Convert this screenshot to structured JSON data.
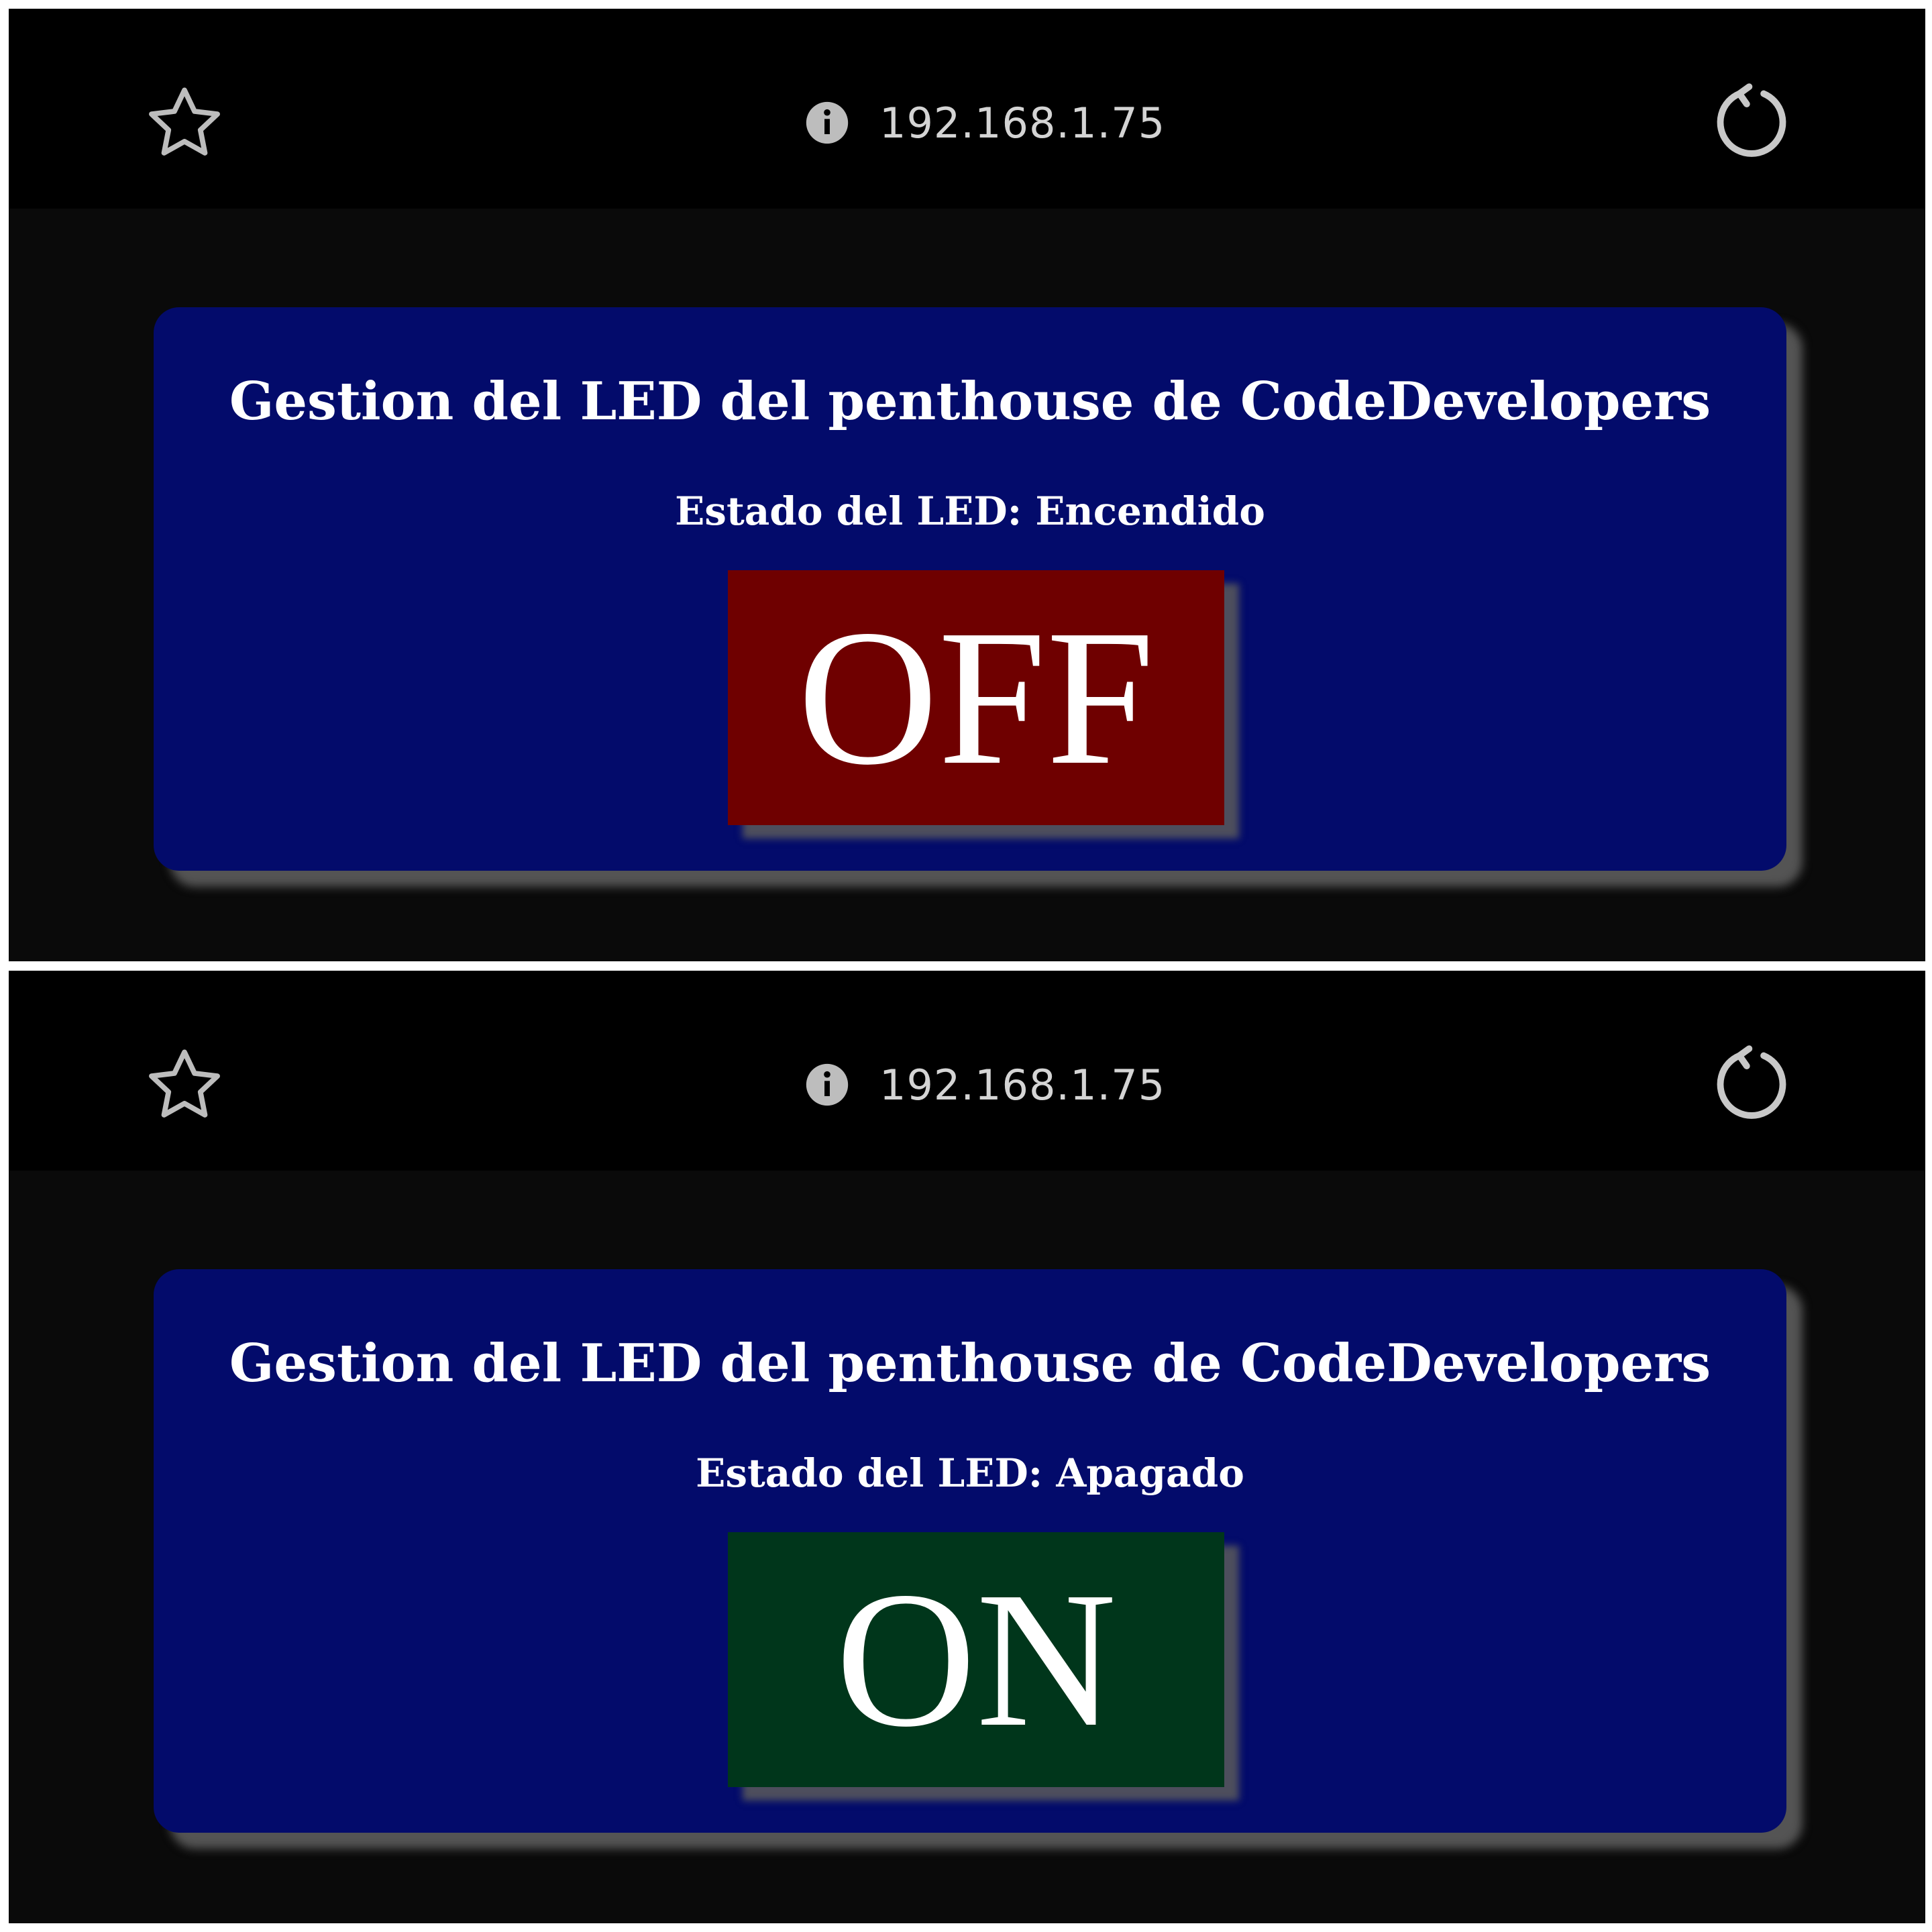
{
  "screens": [
    {
      "browser": {
        "url": "192.168.1.75",
        "icons": {
          "bookmark": "star-outline-icon",
          "info": "info-circle-icon",
          "reload": "reload-icon"
        }
      },
      "card": {
        "title": "Gestion del LED del penthouse de CodeDevelopers",
        "status": "Estado del LED: Encendido",
        "button_label": "OFF",
        "button_color": "#6f0000"
      }
    },
    {
      "browser": {
        "url": "192.168.1.75",
        "icons": {
          "bookmark": "star-outline-icon",
          "info": "info-circle-icon",
          "reload": "reload-icon"
        }
      },
      "card": {
        "title": "Gestion del LED del penthouse de CodeDevelopers",
        "status": "Estado del LED: Apagado",
        "button_label": "ON",
        "button_color": "#00361b"
      }
    }
  ],
  "colors": {
    "card_background": "#030b6b",
    "page_background": "#0a0a0a",
    "address_bar": "#000000",
    "text": "#ffffff"
  }
}
